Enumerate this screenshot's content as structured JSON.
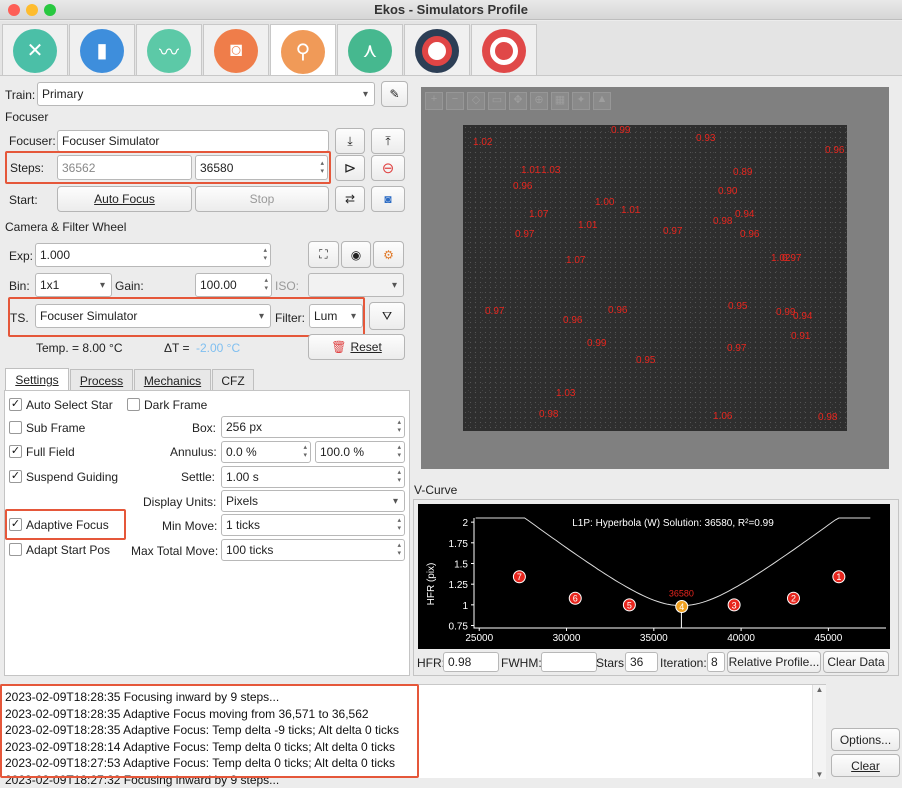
{
  "window": {
    "title": "Ekos - Simulators Profile"
  },
  "main_tabs": [
    {
      "icon": "wrench-screwdriver-icon",
      "color": "#4bbfa7"
    },
    {
      "icon": "notebook-icon",
      "color": "#3e8edc"
    },
    {
      "icon": "curve-graph-icon",
      "color": "#5cc9a7"
    },
    {
      "icon": "camera-icon",
      "color": "#ef7d4a"
    },
    {
      "icon": "magnifier-icon",
      "color": "#f09a58"
    },
    {
      "icon": "telescope-mount-icon",
      "color": "#46b88f"
    },
    {
      "icon": "target-guide-icon",
      "color": "#d64545"
    },
    {
      "icon": "target-align-icon",
      "color": "#d64545"
    }
  ],
  "train": {
    "label": "Train:",
    "value": "Primary"
  },
  "focuser": {
    "section": "Focuser",
    "label": "Focuser:",
    "value": "Focuser Simulator",
    "steps_label": "Steps:",
    "steps_current": "36562",
    "steps_target": "36580",
    "start_label": "Start:",
    "auto_focus": "Auto Focus",
    "stop": "Stop"
  },
  "camera": {
    "section": "Camera & Filter Wheel",
    "exp_label": "Exp:",
    "exp_value": "1.000",
    "bin_label": "Bin:",
    "bin_value": "1x1",
    "gain_label": "Gain:",
    "gain_value": "100.00",
    "iso_label": "ISO:",
    "ts_label": "TS.",
    "ts_value": "Focuser Simulator",
    "filter_label": "Filter:",
    "filter_value": "Lum",
    "temp_text": "Temp. = 8.00 °C",
    "delta_label": "ΔT =",
    "delta_value": "-2.00 °C",
    "reset": "Reset"
  },
  "subtabs": [
    "Settings",
    "Process",
    "Mechanics",
    "CFZ"
  ],
  "settings": {
    "auto_select_star": "Auto Select Star",
    "dark_frame": "Dark Frame",
    "sub_frame": "Sub Frame",
    "box_label": "Box:",
    "box_value": "256 px",
    "full_field": "Full Field",
    "annulus_label": "Annulus:",
    "annulus_min": "0.0 %",
    "annulus_max": "100.0 %",
    "suspend_guiding": "Suspend Guiding",
    "settle_label": "Settle:",
    "settle_value": "1.00 s",
    "display_units_label": "Display Units:",
    "display_units_value": "Pixels",
    "adaptive_focus": "Adaptive Focus",
    "min_move_label": "Min Move:",
    "min_move_value": "1 ticks",
    "adapt_start_pos": "Adapt Start Pos",
    "max_total_move_label": "Max Total Move:",
    "max_total_move_value": "100 ticks"
  },
  "image_stars": [
    {
      "v": "1.02"
    },
    {
      "v": "0.99"
    },
    {
      "v": "0.93"
    },
    {
      "v": "0.96"
    },
    {
      "v": "1.01"
    },
    {
      "v": "1.03"
    },
    {
      "v": "0.89"
    },
    {
      "v": "0.96"
    },
    {
      "v": "0.90"
    },
    {
      "v": "1.00"
    },
    {
      "v": "1.01"
    },
    {
      "v": "1.07"
    },
    {
      "v": "0.94"
    },
    {
      "v": "0.98"
    },
    {
      "v": "1.01"
    },
    {
      "v": "0.97"
    },
    {
      "v": "0.96"
    },
    {
      "v": "0.97"
    },
    {
      "v": "1.07"
    },
    {
      "v": "1.02"
    },
    {
      "v": "0.97"
    },
    {
      "v": "0.97"
    },
    {
      "v": "0.95"
    },
    {
      "v": "0.96"
    },
    {
      "v": "0.99"
    },
    {
      "v": "0.96"
    },
    {
      "v": "0.94"
    },
    {
      "v": "0.91"
    },
    {
      "v": "0.99"
    },
    {
      "v": "0.97"
    },
    {
      "v": "0.95"
    },
    {
      "v": "1.03"
    },
    {
      "v": "0.98"
    },
    {
      "v": "1.06"
    },
    {
      "v": "0.98"
    }
  ],
  "vcurve": {
    "section": "V-Curve",
    "solution": "L1P: Hyperbola (W) Solution: 36580, R²=0.99",
    "ylabel": "HFR (pix)",
    "xticks": [
      "25000",
      "30000",
      "35000",
      "40000",
      "45000"
    ],
    "yticks": [
      "2",
      "1.75",
      "1.5",
      "1.25",
      "1",
      "0.75"
    ]
  },
  "chart_data": {
    "type": "scatter",
    "title": "L1P: Hyperbola (W) Solution: 36580, R²=0.99",
    "ylabel": "HFR (pix)",
    "xlim": [
      24700,
      48300
    ],
    "ylim": [
      0.72,
      2.05
    ],
    "points": [
      {
        "label": "1",
        "x": 45600,
        "y": 1.34
      },
      {
        "label": "2",
        "x": 43000,
        "y": 1.08
      },
      {
        "label": "3",
        "x": 39600,
        "y": 1.0
      },
      {
        "label": "4",
        "x": 36600,
        "y": 0.98
      },
      {
        "label": "5",
        "x": 33600,
        "y": 1.0
      },
      {
        "label": "6",
        "x": 30500,
        "y": 1.08
      },
      {
        "label": "7",
        "x": 27300,
        "y": 1.34
      }
    ],
    "solution_marker": {
      "label": "36580",
      "x": 36580,
      "y": 0.98
    },
    "curve": {
      "a": 0.45,
      "b": 0.28,
      "c": 36580,
      "y0": 0.54
    }
  },
  "stats": {
    "hfr_label": "HFR:",
    "hfr_value": "0.98",
    "fwhm_label": "FWHM:",
    "fwhm_value": "",
    "stars_label": "Stars:",
    "stars_value": "36",
    "iteration_label": "Iteration:",
    "iteration_value": "8",
    "relative_profile": "Relative Profile...",
    "clear_data": "Clear Data"
  },
  "log": [
    "2023-02-09T18:28:35 Focusing inward by 9 steps...",
    "2023-02-09T18:28:35 Adaptive Focus moving from 36,571 to 36,562",
    "2023-02-09T18:28:35 Adaptive Focus: Temp delta -9 ticks; Alt delta 0 ticks",
    "2023-02-09T18:28:14 Adaptive Focus: Temp delta 0 ticks; Alt delta 0 ticks",
    "2023-02-09T18:27:53 Adaptive Focus: Temp delta 0 ticks; Alt delta 0 ticks",
    "2023-02-09T18:27:32 Focusing inward by 9 steps..."
  ],
  "footer": {
    "options": "Options...",
    "clear": "Clear"
  }
}
